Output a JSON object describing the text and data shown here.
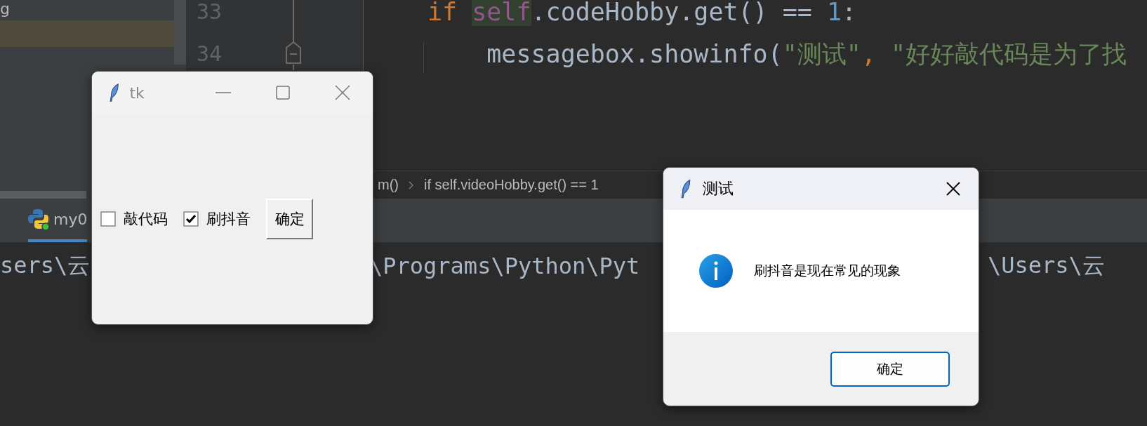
{
  "project_panel": {
    "rows": [
      {
        "label": "g",
        "selected": false
      },
      {
        "selected": true
      }
    ]
  },
  "editor": {
    "line_numbers": [
      "33",
      "34"
    ],
    "lines": [
      {
        "tokens": [
          {
            "kind": "keyword",
            "text": "if "
          },
          {
            "kind": "self",
            "text": "self"
          },
          {
            "kind": "plain",
            "text": ".codeHobby.get() == "
          },
          {
            "kind": "number",
            "text": "1"
          },
          {
            "kind": "plain",
            "text": ":"
          }
        ]
      },
      {
        "tokens": [
          {
            "kind": "plain",
            "text": "    messagebox.showinfo("
          },
          {
            "kind": "string",
            "text": "\"测试\""
          },
          {
            "kind": "keyword",
            "text": ", "
          },
          {
            "kind": "string",
            "text": "\"好好敲代码是为了找"
          }
        ]
      }
    ]
  },
  "breadcrumbs": [
    "m()",
    "if self.videoHobby.get() == 1"
  ],
  "run_tabs": [
    {
      "label": "my0",
      "selected": true
    }
  ],
  "console": {
    "fragments": [
      "sers\\云",
      "\\Programs\\Python\\Pyt",
      "\\Users\\云"
    ]
  },
  "tk_window": {
    "title": "tk",
    "checkboxes": [
      {
        "label": "敲代码",
        "checked": false
      },
      {
        "label": "刷抖音",
        "checked": true
      }
    ],
    "button": "确定"
  },
  "message_dialog": {
    "title": "测试",
    "message": "刷抖音是现在常见的现象",
    "button": "确定"
  }
}
